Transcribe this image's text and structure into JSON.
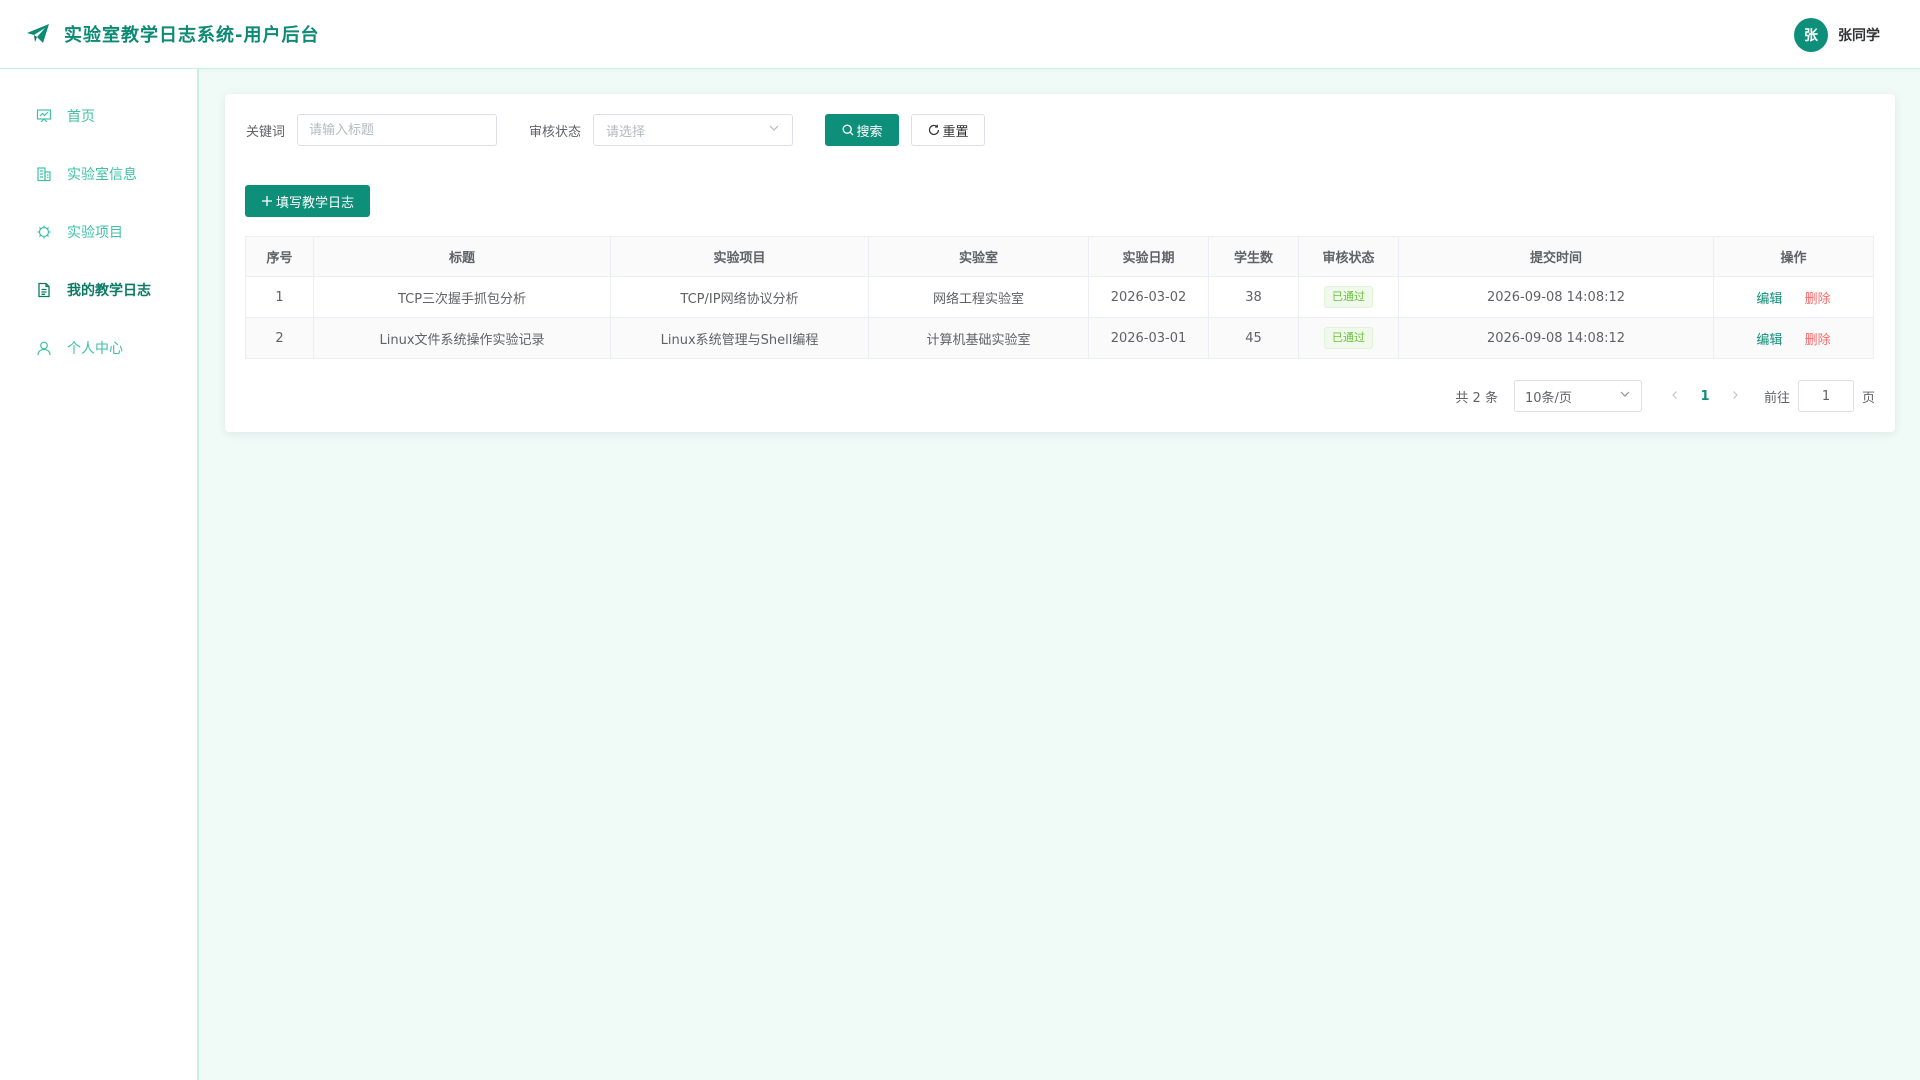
{
  "header": {
    "title": "实验室教学日志系统-用户后台",
    "avatar_text": "张",
    "user_name": "张同学",
    "brand_icon": "paper-plane-icon"
  },
  "sidebar": {
    "items": [
      {
        "label": "首页",
        "icon": "dashboard-icon",
        "active": false
      },
      {
        "label": "实验室信息",
        "icon": "building-icon",
        "active": false
      },
      {
        "label": "实验项目",
        "icon": "chip-icon",
        "active": false
      },
      {
        "label": "我的教学日志",
        "icon": "document-icon",
        "active": true
      },
      {
        "label": "个人中心",
        "icon": "user-icon",
        "active": false
      }
    ]
  },
  "filters": {
    "keyword_label": "关键词",
    "keyword_placeholder": "请输入标题",
    "keyword_value": "",
    "status_label": "审核状态",
    "status_placeholder": "请选择",
    "search_label": "搜索",
    "reset_label": "重置"
  },
  "toolbar": {
    "add_label": "填写教学日志"
  },
  "table": {
    "columns": [
      "序号",
      "标题",
      "实验项目",
      "实验室",
      "实验日期",
      "学生数",
      "审核状态",
      "提交时间",
      "操作"
    ],
    "rows": [
      {
        "index": "1",
        "title": "TCP三次握手抓包分析",
        "project": "TCP/IP网络协议分析",
        "lab": "网络工程实验室",
        "date": "2026-03-02",
        "students": "38",
        "status": "已通过",
        "submitted": "2026-09-08 14:08:12",
        "edit": "编辑",
        "delete": "删除"
      },
      {
        "index": "2",
        "title": "Linux文件系统操作实验记录",
        "project": "Linux系统管理与Shell编程",
        "lab": "计算机基础实验室",
        "date": "2026-03-01",
        "students": "45",
        "status": "已通过",
        "submitted": "2026-09-08 14:08:12",
        "edit": "编辑",
        "delete": "删除"
      }
    ]
  },
  "pagination": {
    "total_text": "共 2 条",
    "page_size": "10条/页",
    "current_page": "1",
    "goto_label": "前往",
    "goto_value": "1",
    "page_suffix": "页"
  },
  "colors": {
    "primary": "#0e8f7a",
    "sidebar_text": "#3fc1a6",
    "danger": "#f56c6c",
    "success": "#67c23a",
    "background": "#f0fbf8"
  }
}
